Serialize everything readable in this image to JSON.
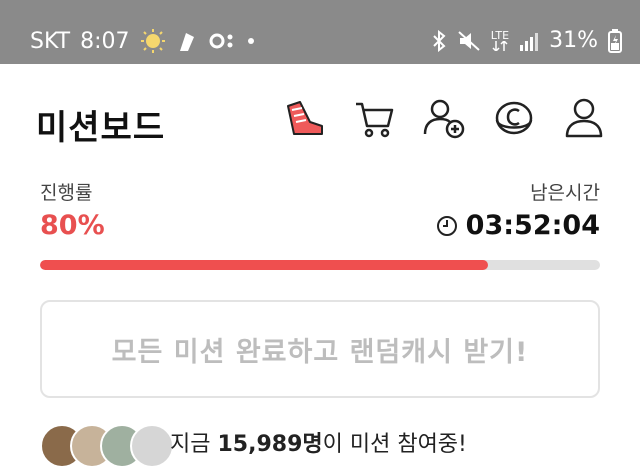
{
  "status_bar": {
    "carrier": "SKT",
    "time": "8:07",
    "network": "LTE",
    "battery": "31%"
  },
  "header": {
    "title": "미션보드",
    "icons": [
      "sneaker-icon",
      "cart-icon",
      "add-friend-icon",
      "coin-icon",
      "profile-icon"
    ]
  },
  "progress": {
    "label": "진행률",
    "value_text": "80%",
    "fraction": 0.8
  },
  "remaining": {
    "label": "남은시간",
    "time": "03:52:04"
  },
  "cta": {
    "label": "모든 미션 완료하고 랜덤캐시 받기!"
  },
  "ticker": {
    "prefix": "지금",
    "count": "15,989명",
    "suffix": "이 미션 참여중!"
  },
  "colors": {
    "accent": "#ef4f4f",
    "status_bar": "#8a8a8a",
    "cta_text": "#bdbdbd"
  }
}
